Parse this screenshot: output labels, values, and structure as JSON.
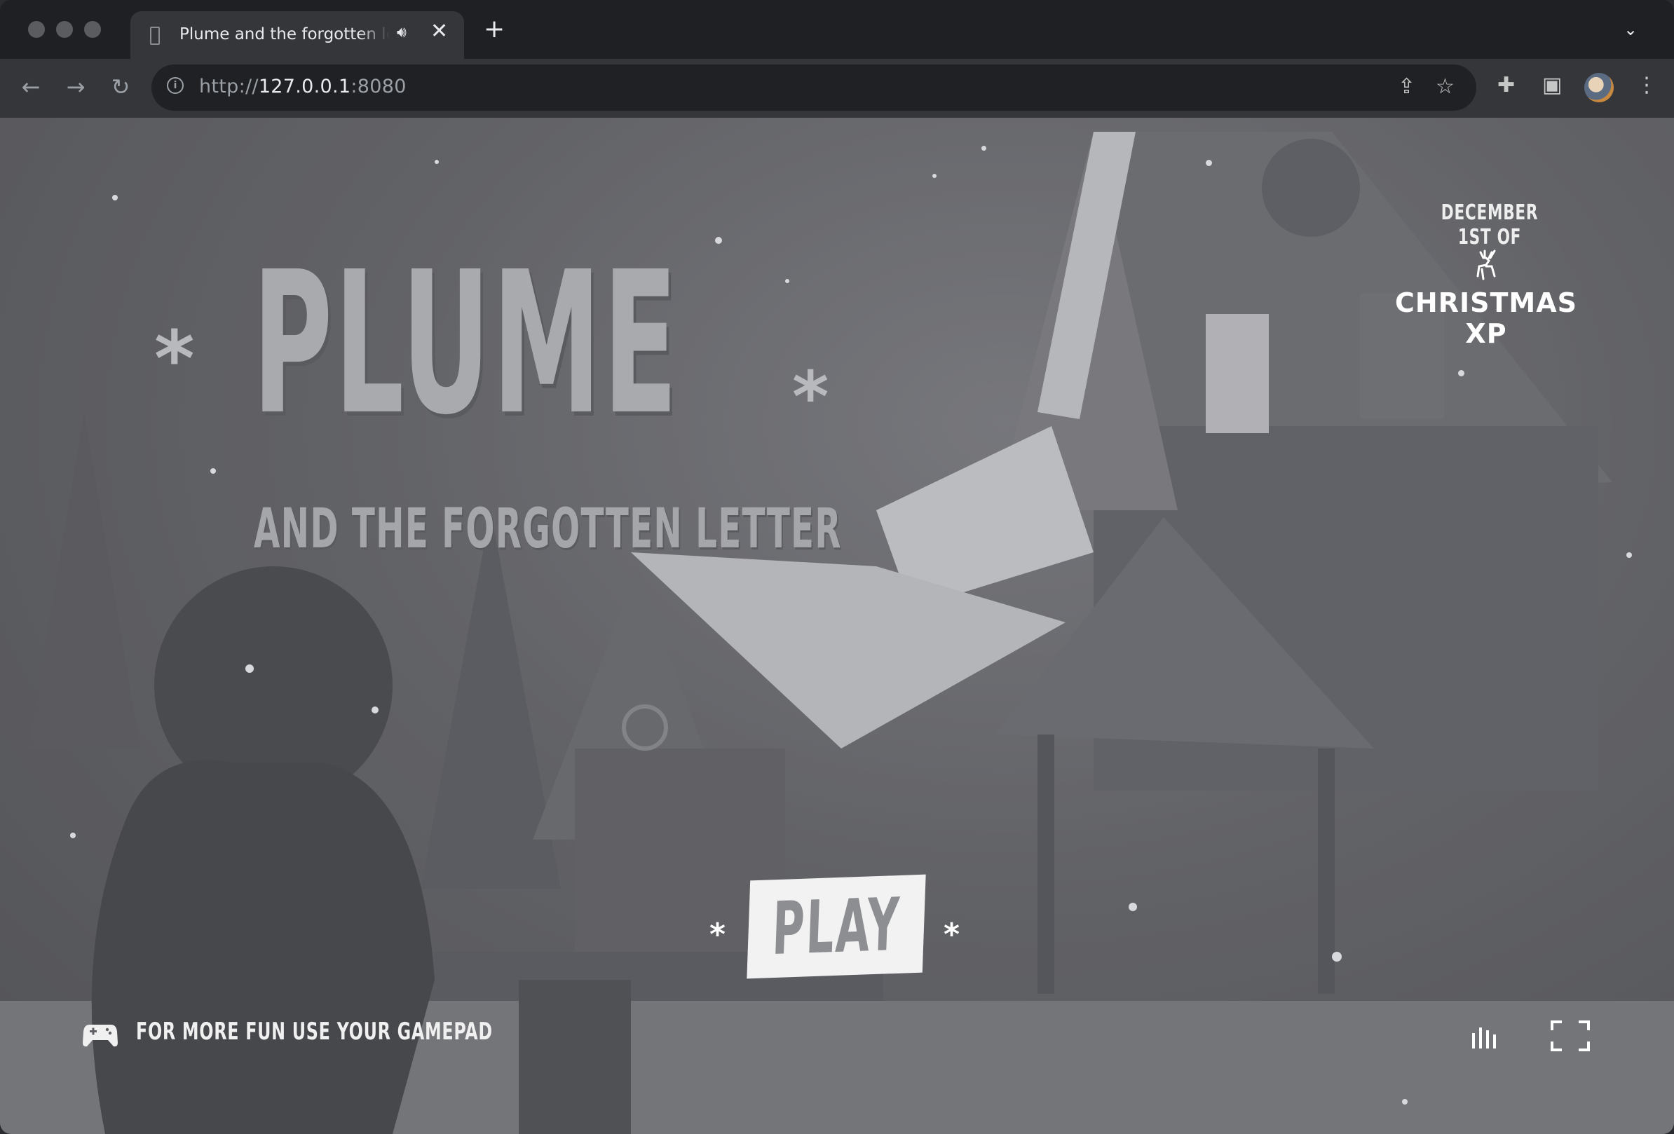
{
  "browser": {
    "tab": {
      "title": "Plume and the forgotten letter",
      "favicon": "page-icon",
      "audio_icon": "speaker-icon",
      "close_icon": "close-icon"
    },
    "new_tab_icon": "plus-icon",
    "tab_search_icon": "chevron-down-icon",
    "nav": {
      "back_icon": "back-arrow-icon",
      "forward_icon": "forward-arrow-icon",
      "reload_icon": "reload-icon"
    },
    "address": {
      "scheme": "http://",
      "host": "127.0.0.1",
      "port": ":8080",
      "info_icon": "info-icon"
    },
    "omnibox_icons": [
      "share-icon",
      "star-icon"
    ],
    "toolbar_icons": [
      "extensions-icon",
      "side-panel-icon",
      "avatar",
      "more-icon"
    ]
  },
  "game": {
    "title": "PLUME",
    "subtitle": "AND THE FORGOTTEN LETTER",
    "christmas": {
      "date_label": "DECEMBER 1ST OF",
      "brand": "CHRISTMAS XP",
      "logo_icon": "reindeer-icon"
    },
    "play_button": {
      "label": "PLAY"
    },
    "gamepad_hint": {
      "text": "FOR MORE FUN USE YOUR GAMEPAD",
      "icon": "gamepad-icon"
    },
    "controls": {
      "sound_icon": "sound-bars-icon",
      "fullscreen_icon": "fullscreen-icon"
    }
  },
  "colors": {
    "tabstrip": "#1f2023",
    "toolbar": "#35363a",
    "omnibox": "#202124",
    "scene": "#5f6064",
    "play_bg": "#f2f2f3"
  }
}
